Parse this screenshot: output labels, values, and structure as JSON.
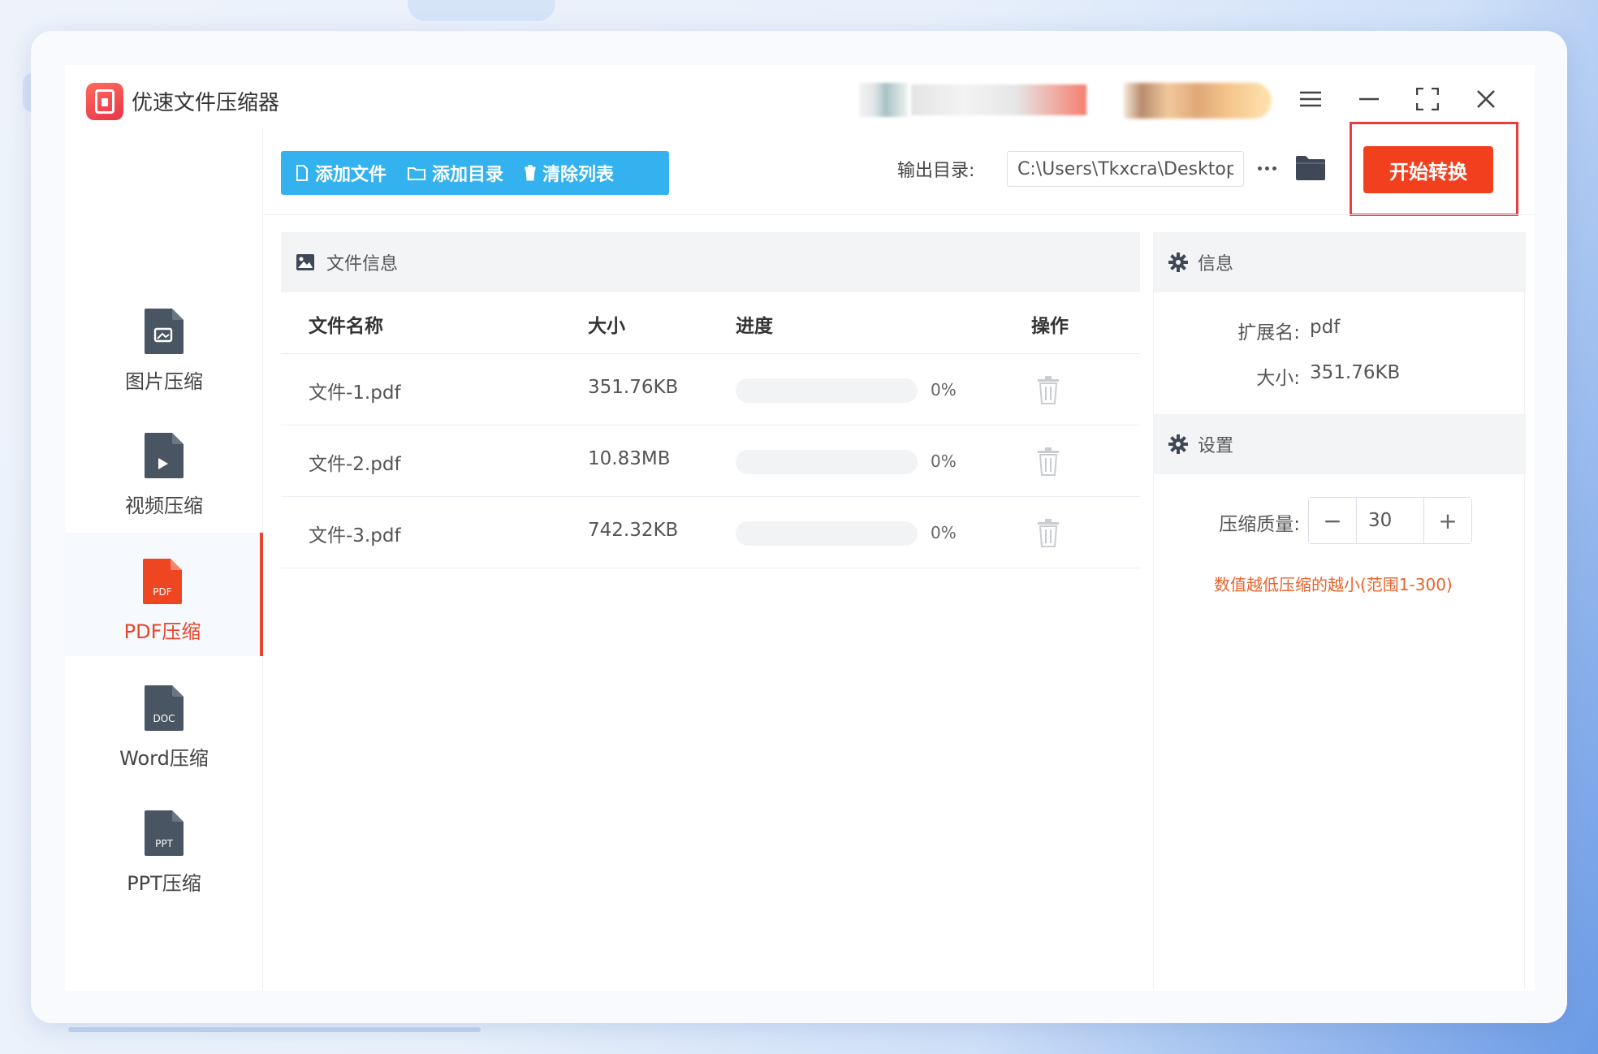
{
  "app": {
    "title": "优速文件压缩器"
  },
  "colors": {
    "accent": "#33b2ef",
    "danger": "#f2401f",
    "active_nav": "#e9442e",
    "hint": "#e9632c"
  },
  "window_controls": [
    "menu-icon",
    "minimize-icon",
    "maximize-icon",
    "close-icon"
  ],
  "sidebar": {
    "items": [
      {
        "label": "图片压缩",
        "icon": "image-file-icon",
        "active": false
      },
      {
        "label": "视频压缩",
        "icon": "video-file-icon",
        "active": false
      },
      {
        "label": "PDF压缩",
        "icon": "pdf-file-icon",
        "active": true,
        "icon_text": "PDF"
      },
      {
        "label": "Word压缩",
        "icon": "doc-file-icon",
        "active": false,
        "icon_text": "DOC"
      },
      {
        "label": "PPT压缩",
        "icon": "ppt-file-icon",
        "active": false,
        "icon_text": "PPT"
      }
    ]
  },
  "toolbar": {
    "add_file": "添加文件",
    "add_folder": "添加目录",
    "clear_list": "清除列表",
    "output_label": "输出目录:",
    "output_path": "C:\\Users\\Tkxcra\\Desktop",
    "start": "开始转换"
  },
  "file_panel": {
    "title": "文件信息",
    "columns": {
      "name": "文件名称",
      "size": "大小",
      "progress": "进度",
      "action": "操作"
    },
    "rows": [
      {
        "name": "文件-1.pdf",
        "size": "351.76KB",
        "progress": 0,
        "progress_text": "0%"
      },
      {
        "name": "文件-2.pdf",
        "size": "10.83MB",
        "progress": 0,
        "progress_text": "0%"
      },
      {
        "name": "文件-3.pdf",
        "size": "742.32KB",
        "progress": 0,
        "progress_text": "0%"
      }
    ]
  },
  "info_panel": {
    "title": "信息",
    "ext_label": "扩展名:",
    "ext_value": "pdf",
    "size_label": "大小:",
    "size_value": "351.76KB"
  },
  "settings_panel": {
    "title": "设置",
    "quality_label": "压缩质量:",
    "quality_value": "30",
    "minus": "−",
    "plus": "+",
    "hint": "数值越低压缩的越小(范围1-300)"
  }
}
